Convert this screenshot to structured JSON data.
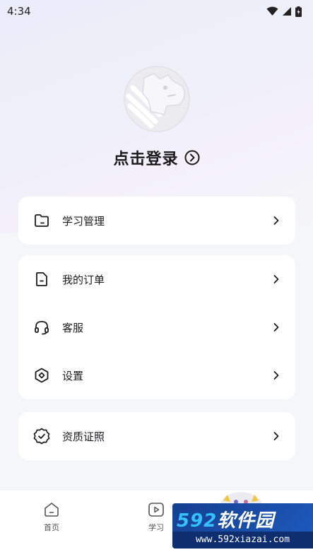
{
  "status_bar": {
    "time": "4:34"
  },
  "header": {
    "login_label": "点击登录"
  },
  "menu_cards": [
    {
      "items": [
        {
          "label": "学习管理",
          "icon": "folder-icon"
        }
      ]
    },
    {
      "items": [
        {
          "label": "我的订单",
          "icon": "document-icon"
        },
        {
          "label": "客服",
          "icon": "headset-icon"
        },
        {
          "label": "设置",
          "icon": "settings-hex-icon"
        }
      ]
    },
    {
      "items": [
        {
          "label": "资质证照",
          "icon": "badge-check-icon"
        }
      ]
    }
  ],
  "tabbar": {
    "tabs": [
      {
        "label": "首页",
        "icon": "home-icon"
      },
      {
        "label": "学习",
        "icon": "play-icon"
      }
    ]
  },
  "watermark": {
    "brand_num": "592",
    "brand_text": "软件园",
    "url": "www.592xiazai.com"
  },
  "colors": {
    "accent_dark": "#1c1c1e",
    "card_bg": "#ffffff",
    "page_bg": "#f5f6f8"
  }
}
